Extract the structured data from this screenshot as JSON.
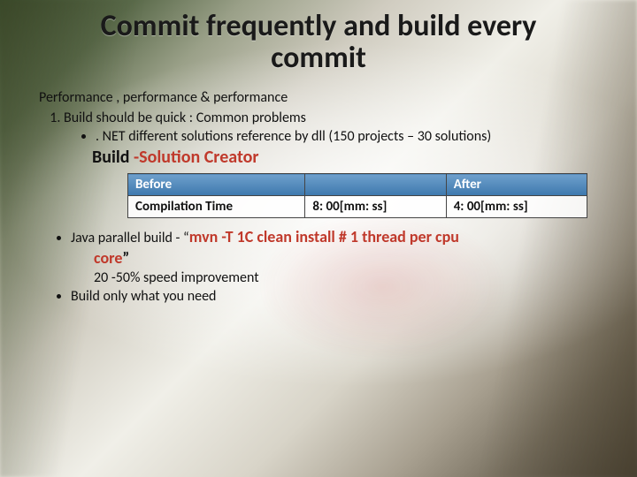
{
  "title": "Commit frequently and build every commit",
  "subtitle": "Performance , performance & performance",
  "list_item_1": "Build should be quick  : Common problems",
  "bullet_net": ". NET different solutions reference by dll (150 projects – 30 solutions)",
  "solution_prefix": "Build ",
  "solution_red": "-Solution Creator",
  "table": {
    "h_before": "Before",
    "h_blank": "",
    "h_after": "After",
    "r_label": "Compilation Time",
    "r_before": "8: 00[mm: ss]",
    "r_after": "4: 00[mm: ss]"
  },
  "parallel_prefix": "Java parallel build  - “",
  "parallel_cmd": "mvn -T 1C clean install # 1 thread per cpu",
  "core_red": "core",
  "core_close": "”",
  "improvement": "20 -50% speed improvement",
  "bullet_only": "Build only what you need",
  "chart_data": {
    "type": "table",
    "categories": [
      "Before",
      "After"
    ],
    "values_mm_ss": [
      "8:00",
      "4:00"
    ],
    "label": "Compilation Time",
    "unit": "mm:ss"
  }
}
